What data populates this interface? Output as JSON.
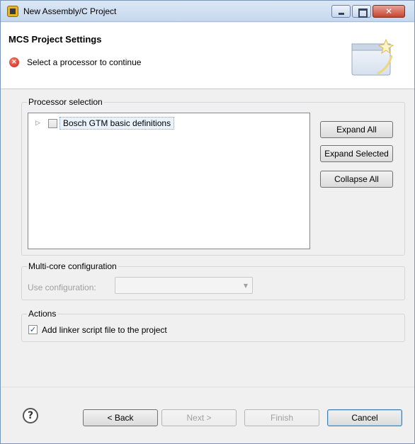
{
  "window": {
    "title": "New Assembly/C Project"
  },
  "header": {
    "title": "MCS Project Settings",
    "message": "Select a processor to continue",
    "message_icon": "error-icon"
  },
  "processor_selection": {
    "label": "Processor selection",
    "tree_items": [
      {
        "label": "Bosch GTM basic definitions",
        "checked": false,
        "expanded": false
      }
    ],
    "buttons": {
      "expand_all": "Expand All",
      "expand_selected": "Expand Selected",
      "collapse_all": "Collapse All"
    }
  },
  "multicore": {
    "label": "Multi-core configuration",
    "use_configuration_label": "Use configuration:",
    "selected_value": ""
  },
  "actions": {
    "label": "Actions",
    "add_linker_script": {
      "label": "Add linker script file to the project",
      "checked": true
    }
  },
  "footer": {
    "back": "< Back",
    "next": "Next >",
    "finish": "Finish",
    "cancel": "Cancel"
  },
  "colors": {
    "accent": "#3c7fb1",
    "error": "#c6231a",
    "disabled_text": "#a0a0a0"
  }
}
